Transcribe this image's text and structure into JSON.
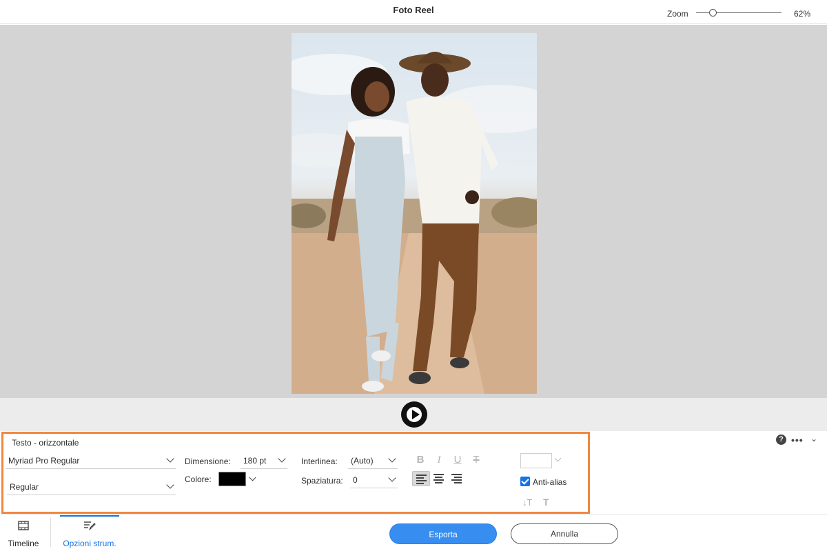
{
  "header": {
    "title": "Foto Reel",
    "zoom_label": "Zoom",
    "zoom_value": "62%",
    "zoom_fraction": 0.2
  },
  "canvas": {
    "photo_icon": "couple-walking-photo"
  },
  "player": {
    "play_icon": "play-icon"
  },
  "tool_options": {
    "title": "Testo - orizzontale",
    "font_family": "Myriad Pro Regular",
    "font_style": "Regular",
    "size_label": "Dimensione:",
    "size_value": "180 pt",
    "leading_label": "Interlinea:",
    "leading_value": "(Auto)",
    "color_label": "Colore:",
    "color_value": "#000000",
    "tracking_label": "Spaziatura:",
    "tracking_value": "0",
    "format_buttons": {
      "bold": "B",
      "italic": "I",
      "underline": "U",
      "strike": "T"
    },
    "align": {
      "active": "left"
    },
    "anti_alias_label": "Anti-alias",
    "anti_alias_checked": true,
    "highlight_color": "#f0883e"
  },
  "bottom_bar": {
    "tab_timeline": "Timeline",
    "tab_options": "Opzioni strum.",
    "export_label": "Esporta",
    "cancel_label": "Annulla",
    "accent_color": "#378ef0"
  }
}
